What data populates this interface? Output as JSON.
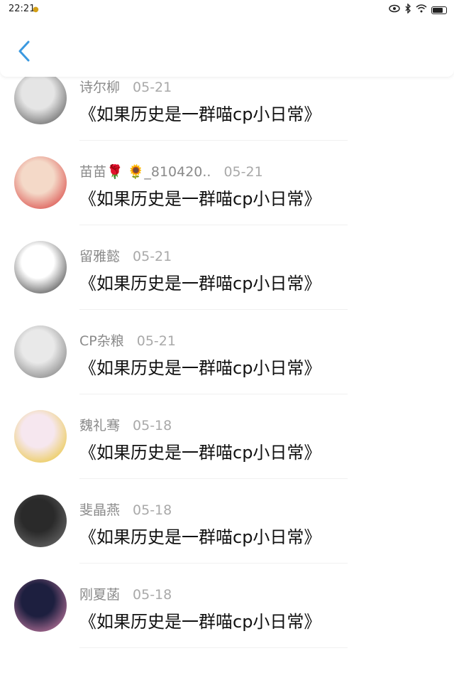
{
  "status_bar": {
    "time": "22:21",
    "battery_level": 0.8
  },
  "header": {
    "back_icon": "chevron-left-icon",
    "accent_color": "#3b99e0"
  },
  "comments": [
    {
      "user": "",
      "date": "",
      "text": "《如果历史是一群喵cp小日常》",
      "avatar_colors": [
        "#222222",
        "#555555"
      ]
    },
    {
      "user": "诗尔柳",
      "date": "05-21",
      "text": "《如果历史是一群喵cp小日常》",
      "avatar_colors": [
        "#e5e5e5",
        "#444444"
      ]
    },
    {
      "user": "苗苗🌹 🌻_810420..",
      "date": "05-21",
      "text": "《如果历史是一群喵cp小日常》",
      "avatar_colors": [
        "#f4d9c8",
        "#d42a2a"
      ]
    },
    {
      "user": "留雅懿",
      "date": "05-21",
      "text": "《如果历史是一群喵cp小日常》",
      "avatar_colors": [
        "#ffffff",
        "#222222"
      ]
    },
    {
      "user": "CP杂粮",
      "date": "05-21",
      "text": "《如果历史是一群喵cp小日常》",
      "avatar_colors": [
        "#e9e9e9",
        "#6b6b6b"
      ]
    },
    {
      "user": "魏礼骞",
      "date": "05-18",
      "text": "《如果历史是一群喵cp小日常》",
      "avatar_colors": [
        "#f6e7ef",
        "#e8c11c"
      ]
    },
    {
      "user": "斐晶燕",
      "date": "05-18",
      "text": "《如果历史是一群喵cp小日常》",
      "avatar_colors": [
        "#2a2a2a",
        "#777777"
      ]
    },
    {
      "user": "刚夏菡",
      "date": "05-18",
      "text": "《如果历史是一群喵cp小日常》",
      "avatar_colors": [
        "#1d1f3f",
        "#e58bb4"
      ]
    }
  ]
}
